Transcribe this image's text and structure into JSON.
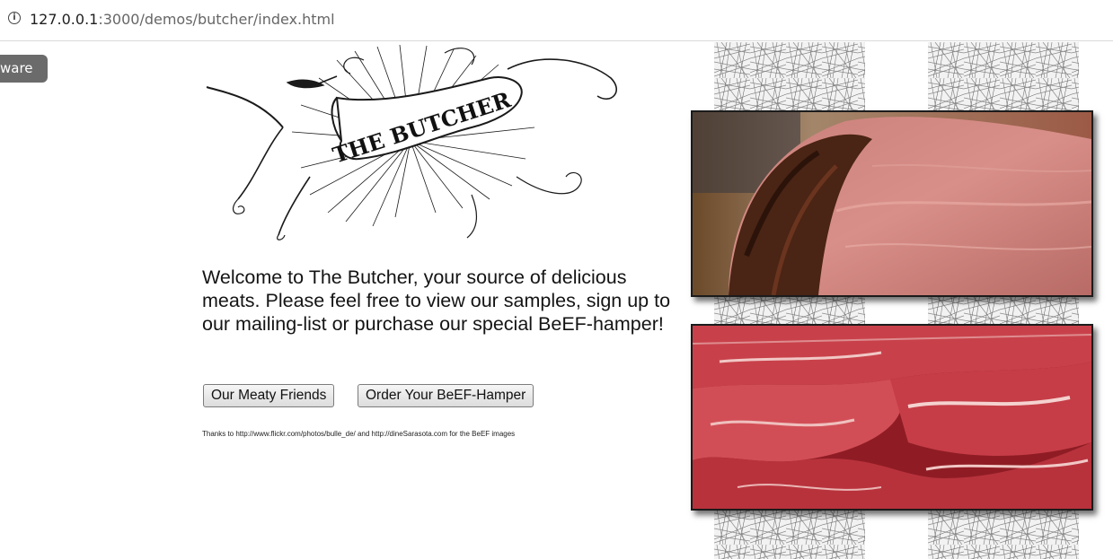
{
  "browser": {
    "url_host": "127.0.0.1",
    "url_rest": ":3000/demos/butcher/index.html",
    "badge_text": "ware"
  },
  "logo": {
    "banner_text": "THE BUTCHER",
    "icon": "engraved-banner-logo"
  },
  "main": {
    "welcome_text": "Welcome to The Butcher, your source of delicious meats. Please feel free to view our samples, sign up to our mailing-list or purchase our special BeEF-hamper!",
    "buttons": {
      "meaty_friends": "Our Meaty Friends",
      "order_hamper": "Order Your BeEF-Hamper"
    },
    "credits": "Thanks to http://www.flickr.com/photos/bulle_de/ and http://dineSarasota.com for the BeEF images"
  },
  "photos": {
    "roast_icon": "roast-beef-photo",
    "raw_icon": "raw-beef-photo"
  }
}
